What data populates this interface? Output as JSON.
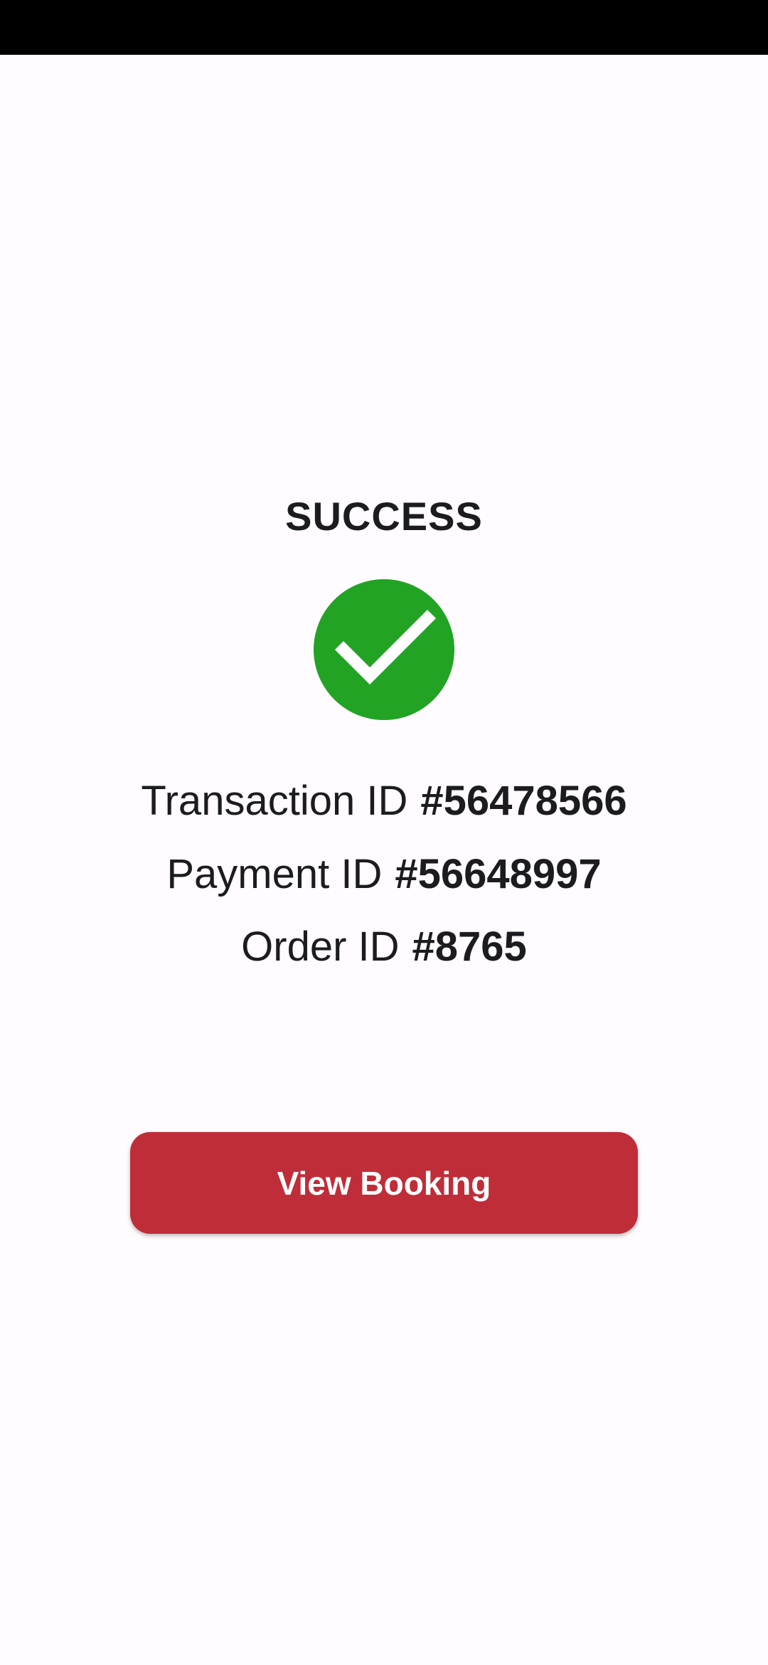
{
  "title": "SUCCESS",
  "status_icon": "checkmark-circle-icon",
  "colors": {
    "success_green": "#22a324",
    "button_red": "#bf2d38",
    "background": "#fffbfe",
    "text": "#1c1b1f"
  },
  "ids": {
    "transaction": {
      "label": "Transaction ID",
      "value": "#56478566"
    },
    "payment": {
      "label": "Payment ID",
      "value": "#56648997"
    },
    "order": {
      "label": "Order ID",
      "value": "#8765"
    }
  },
  "button": {
    "label": "View Booking"
  }
}
